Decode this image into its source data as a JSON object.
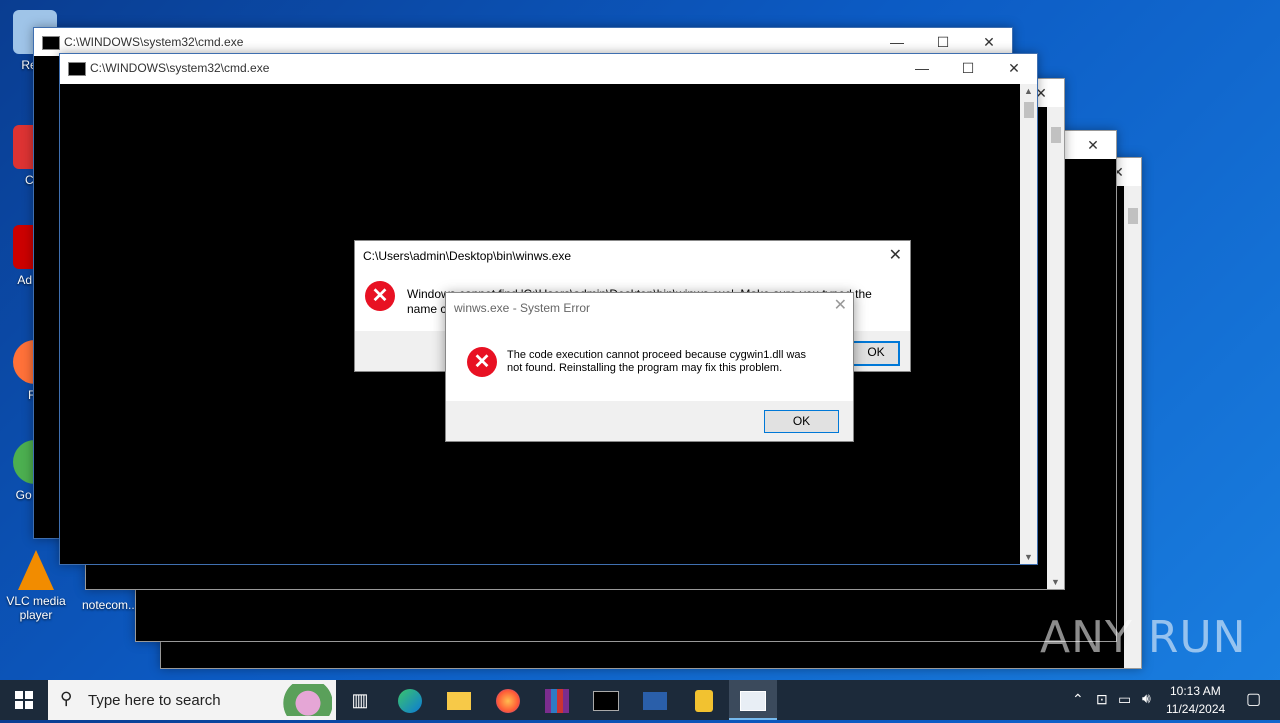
{
  "desktop": {
    "icons": [
      {
        "label": "Recy",
        "name": "recycle-bin-icon"
      },
      {
        "label": "CCl",
        "name": "ccleaner-icon"
      },
      {
        "label": "Ad Acr",
        "name": "acrobat-icon"
      },
      {
        "label": "Fir",
        "name": "firefox-desktop-icon"
      },
      {
        "label": "Go Chr",
        "name": "chrome-desktop-icon"
      },
      {
        "label": "VLC media player",
        "name": "vlc-icon"
      },
      {
        "label": "notecom...",
        "name": "notepad-file-icon"
      }
    ]
  },
  "windows": {
    "cmd_back_title": "C:\\WINDOWS\\system32\\cmd.exe",
    "cmd_front_title": "C:\\WINDOWS\\system32\\cmd.exe"
  },
  "dialog_main": {
    "title": "C:\\Users\\admin\\Desktop\\bin\\winws.exe",
    "message": "Windows cannot find 'C:\\Users\\admin\\Desktop\\bin\\winws.exe'. Make sure you typed the name c",
    "ok_label": "OK"
  },
  "dialog_error": {
    "title": "winws.exe - System Error",
    "message_line1": "The code execution cannot proceed because cygwin1.dll was",
    "message_line2": "not found. Reinstalling the program may fix this problem.",
    "ok_label": "OK"
  },
  "watermark": {
    "text": "ANY RUN"
  },
  "taskbar": {
    "search_placeholder": "Type here to search",
    "time": "10:13 AM",
    "date": "11/24/2024"
  },
  "colors": {
    "accent": "#0078d7",
    "error": "#e81123",
    "taskbar": "#1c2a3a"
  }
}
